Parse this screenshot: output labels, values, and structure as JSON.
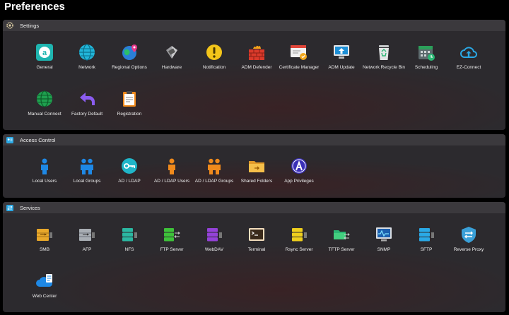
{
  "page_title": "Preferences",
  "sections": {
    "settings": {
      "title": "Settings",
      "icon": "gear-icon",
      "items": [
        {
          "label": "General",
          "icon": "general-icon"
        },
        {
          "label": "Network",
          "icon": "globe-network-icon"
        },
        {
          "label": "Regional Options",
          "icon": "globe-pin-icon"
        },
        {
          "label": "Hardware",
          "icon": "hardware-icon"
        },
        {
          "label": "Notification",
          "icon": "exclamation-icon"
        },
        {
          "label": "ADM Defender",
          "icon": "firewall-icon"
        },
        {
          "label": "Certificate Manager",
          "icon": "certificate-icon"
        },
        {
          "label": "ADM Update",
          "icon": "update-icon"
        },
        {
          "label": "Network Recycle Bin",
          "icon": "recycle-bin-icon"
        },
        {
          "label": "Scheduling",
          "icon": "calendar-icon"
        },
        {
          "label": "EZ-Connect",
          "icon": "cloud-upload-icon"
        },
        {
          "label": "Manual Connect",
          "icon": "globe-green-icon"
        },
        {
          "label": "Factory Default",
          "icon": "undo-arrow-icon"
        },
        {
          "label": "Registration",
          "icon": "clipboard-icon"
        }
      ]
    },
    "access_control": {
      "title": "Access Control",
      "icon": "id-card-icon",
      "items": [
        {
          "label": "Local Users",
          "icon": "user-blue-icon"
        },
        {
          "label": "Local Groups",
          "icon": "group-blue-icon"
        },
        {
          "label": "AD / LDAP",
          "icon": "key-icon"
        },
        {
          "label": "AD / LDAP Users",
          "icon": "user-orange-icon"
        },
        {
          "label": "AD / LDAP Groups",
          "icon": "group-orange-icon"
        },
        {
          "label": "Shared Folders",
          "icon": "folder-icon"
        },
        {
          "label": "App Privileges",
          "icon": "app-privileges-icon"
        }
      ]
    },
    "services": {
      "title": "Services",
      "icon": "services-icon",
      "items": [
        {
          "label": "SMB",
          "icon": "smb-icon"
        },
        {
          "label": "AFP",
          "icon": "afp-icon"
        },
        {
          "label": "NFS",
          "icon": "nfs-icon"
        },
        {
          "label": "FTP Server",
          "icon": "ftp-icon"
        },
        {
          "label": "WebDAV",
          "icon": "webdav-icon"
        },
        {
          "label": "Terminal",
          "icon": "terminal-icon"
        },
        {
          "label": "Rsync Server",
          "icon": "rsync-icon"
        },
        {
          "label": "TFTP Server",
          "icon": "tftp-icon"
        },
        {
          "label": "SNMP",
          "icon": "snmp-icon"
        },
        {
          "label": "SFTP",
          "icon": "sftp-icon"
        },
        {
          "label": "Reverse Proxy",
          "icon": "reverse-proxy-icon"
        },
        {
          "label": "Web Center",
          "icon": "web-center-icon"
        }
      ]
    }
  },
  "colors": {
    "background": "#000000",
    "panel": "#2c2a2e",
    "panel_header": "#3b393d",
    "text": "#eeeeee"
  }
}
